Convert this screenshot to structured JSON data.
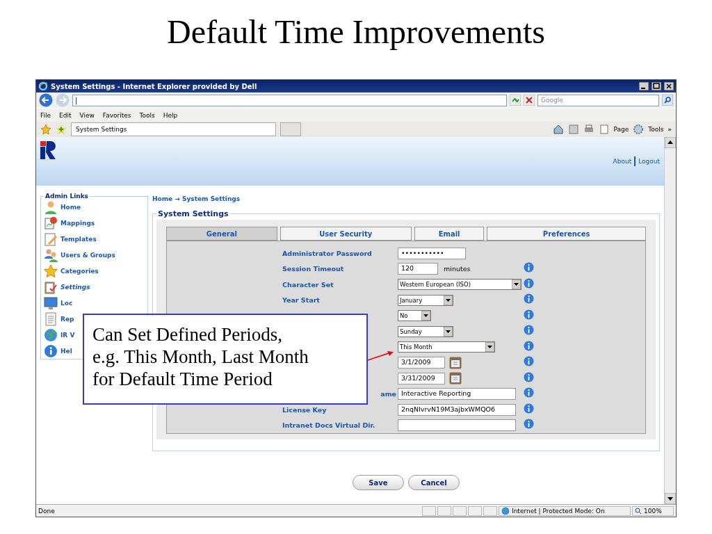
{
  "slide": {
    "title": "Default Time Improvements",
    "callout": [
      "Can Set Defined Periods,",
      "e.g. This Month, Last Month",
      "for Default Time Period"
    ]
  },
  "window": {
    "title": "System Settings - Internet Explorer provided by Dell"
  },
  "address_bar": {
    "value": "|",
    "search_placeholder": "Google"
  },
  "menu": [
    "File",
    "Edit",
    "View",
    "Favorites",
    "Tools",
    "Help"
  ],
  "tab": {
    "label": "System Settings"
  },
  "command_bar": [
    "Page",
    "Tools",
    "»"
  ],
  "header_links": [
    "About",
    "Logout"
  ],
  "sidebar": {
    "title": "Admin Links",
    "items": [
      {
        "label": "Home",
        "selected": false
      },
      {
        "label": "Mappings",
        "selected": false
      },
      {
        "label": "Templates",
        "selected": false
      },
      {
        "label": "Users & Groups",
        "selected": false
      },
      {
        "label": "Categories",
        "selected": false
      },
      {
        "label": "Settings",
        "selected": true
      },
      {
        "label": "Loc",
        "selected": false
      },
      {
        "label": "Rep",
        "selected": false
      },
      {
        "label": "IR V",
        "selected": false
      },
      {
        "label": "Hel",
        "selected": false
      }
    ]
  },
  "breadcrumb": [
    "Home",
    "→",
    "System Settings"
  ],
  "panel": {
    "title": "System Settings"
  },
  "tabs": [
    {
      "label": "General",
      "selected": true
    },
    {
      "label": "User Security",
      "selected": false
    },
    {
      "label": "Email",
      "selected": false
    },
    {
      "label": "Preferences",
      "selected": false
    }
  ],
  "form": [
    {
      "label": "Administrator Password",
      "kind": "text",
      "value": "•••••••••••",
      "info": false
    },
    {
      "label": "Session Timeout",
      "kind": "text",
      "value": "120",
      "suffix": "minutes",
      "info": true
    },
    {
      "label": "Character Set",
      "kind": "select",
      "value": "Western European (ISO)",
      "info": true
    },
    {
      "label": "Year Start",
      "kind": "select",
      "value": "January",
      "info": true
    },
    {
      "kind": "select",
      "value": "No",
      "info": true
    },
    {
      "kind": "select",
      "value": "Sunday",
      "info": true
    },
    {
      "kind": "select",
      "value": "This Month",
      "info": true
    },
    {
      "kind": "date",
      "value": "3/1/2009",
      "info": true
    },
    {
      "kind": "date",
      "value": "3/31/2009",
      "info": true
    },
    {
      "label": "ame",
      "kind": "text",
      "value": "Interactive Reporting",
      "info": true
    },
    {
      "label": "License Key",
      "kind": "text",
      "value": "2nqNlvrvN19M3ajbxWMQO6",
      "info": true
    },
    {
      "label": "Intranet Docs Virtual Dir.",
      "kind": "text",
      "info": true
    }
  ],
  "buttons": [
    "Save",
    "Cancel"
  ],
  "status_bar": {
    "text": "Done",
    "zone": "Internet | Protected Mode: On",
    "zoom": "100%"
  }
}
